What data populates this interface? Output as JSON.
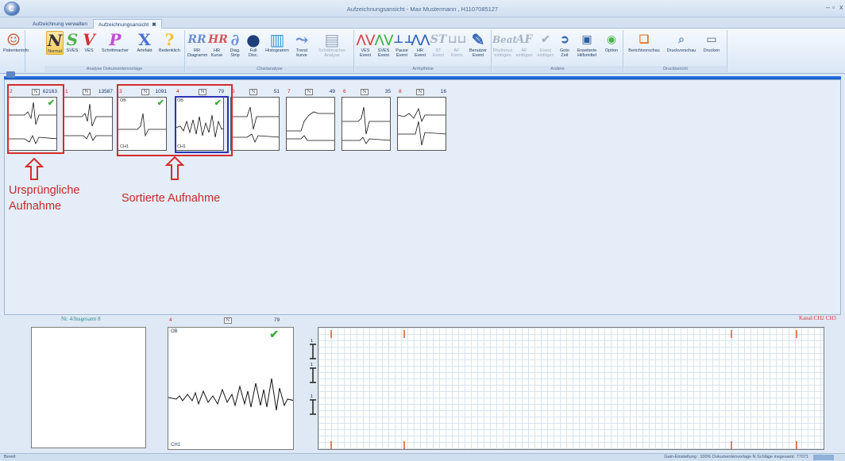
{
  "window": {
    "title": "Aufzeichnungsansicht  -  Max Mustermann , H1107085127",
    "min": "–",
    "max": "▫",
    "close": "x"
  },
  "tabs": [
    {
      "label": "Aufzeichnung verwalten"
    },
    {
      "label": "Aufzeichnungsansicht",
      "close": "✖"
    }
  ],
  "ribbon": {
    "groups": [
      {
        "label": "Analyse Dokumentenvorlage"
      },
      {
        "label": "Chartanalyse"
      },
      {
        "label": "Arrhythmie"
      },
      {
        "label": "Andere"
      },
      {
        "label": "Druckbericht"
      }
    ],
    "buttons": {
      "patienteninfo": "Patienteninfo",
      "normal": "Normal",
      "sves": "SVES",
      "ves": "VES",
      "schrittmacher": "Schrittmacher",
      "artefakt": "Artefakt",
      "bedenklich": "Bedenklich",
      "rr": "RR\nDiagramm",
      "hr": "HR\nKurve",
      "diag": "Diag.\nStrip",
      "full": "Full\nDisc.",
      "histogramm": "Histogramm",
      "trend": "Trend\nkurve",
      "sm_analyse": "Schrittmacher\nAnalyse",
      "ves_event": "VES\nEvent",
      "sves_event": "SVES\nEvent",
      "pause_event": "Pause\nEvent",
      "hr_event": "HR\nEvent",
      "st_event": "ST\nEvent",
      "af_event": "AF\nEvent",
      "benutzer_event": "Benutzer\nEvent",
      "rhythmus": "Rhythmus\neinfügen",
      "af_einf": "AF\neinfügen",
      "event_einf": "Event\neinfügen",
      "goto": "Goto\nZeit",
      "hilfsmittel": "Erweiterte\nHilfsmittel",
      "option": "Option",
      "berichtvorschau": "Berichtvorschau",
      "druckvorschau": "Druckvorschau",
      "drucken": "Drucken"
    }
  },
  "cards": [
    {
      "index": "2",
      "label": "N",
      "count": "62163",
      "ob": "",
      "ch": "",
      "checked": true
    },
    {
      "index": "1",
      "label": "N",
      "count": "13587",
      "ob": "",
      "ch": "",
      "checked": false
    },
    {
      "index": "3",
      "label": "N",
      "count": "1091",
      "ob": "OB",
      "ch": "CH1",
      "checked": true
    },
    {
      "index": "4",
      "label": "N",
      "count": "79",
      "ob": "OB",
      "ch": "CH1",
      "checked": true
    },
    {
      "index": "5",
      "label": "N",
      "count": "51",
      "ob": "",
      "ch": "",
      "checked": false
    },
    {
      "index": "7",
      "label": "N",
      "count": "49",
      "ob": "",
      "ch": "",
      "checked": false
    },
    {
      "index": "6",
      "label": "N",
      "count": "35",
      "ob": "",
      "ch": "",
      "checked": false
    },
    {
      "index": "8",
      "label": "N",
      "count": "16",
      "ob": "",
      "ch": "",
      "checked": false
    }
  ],
  "annotations": {
    "original": "Ursprüngliche\nAufnahme",
    "sorted": "Sortierte Aufnahme"
  },
  "bottom": {
    "nr_title": "Nr. 4/Insgesamt 8",
    "detail": {
      "index": "4",
      "label": "N",
      "count": "79",
      "ob": "OB",
      "ch": "CH1"
    },
    "kanal": "Kanal:CH2 CH3",
    "marker": "1"
  },
  "status": {
    "left": "Bereit",
    "right": "Gain-Einstellung : 100%   Dokumentenvorlage N Schläge insgesamt: 77071"
  },
  "colors": {
    "accent": "#1059c4",
    "highlight_red": "#d42c2c",
    "highlight_blue": "#2a33b6",
    "check": "#3daa3d"
  }
}
